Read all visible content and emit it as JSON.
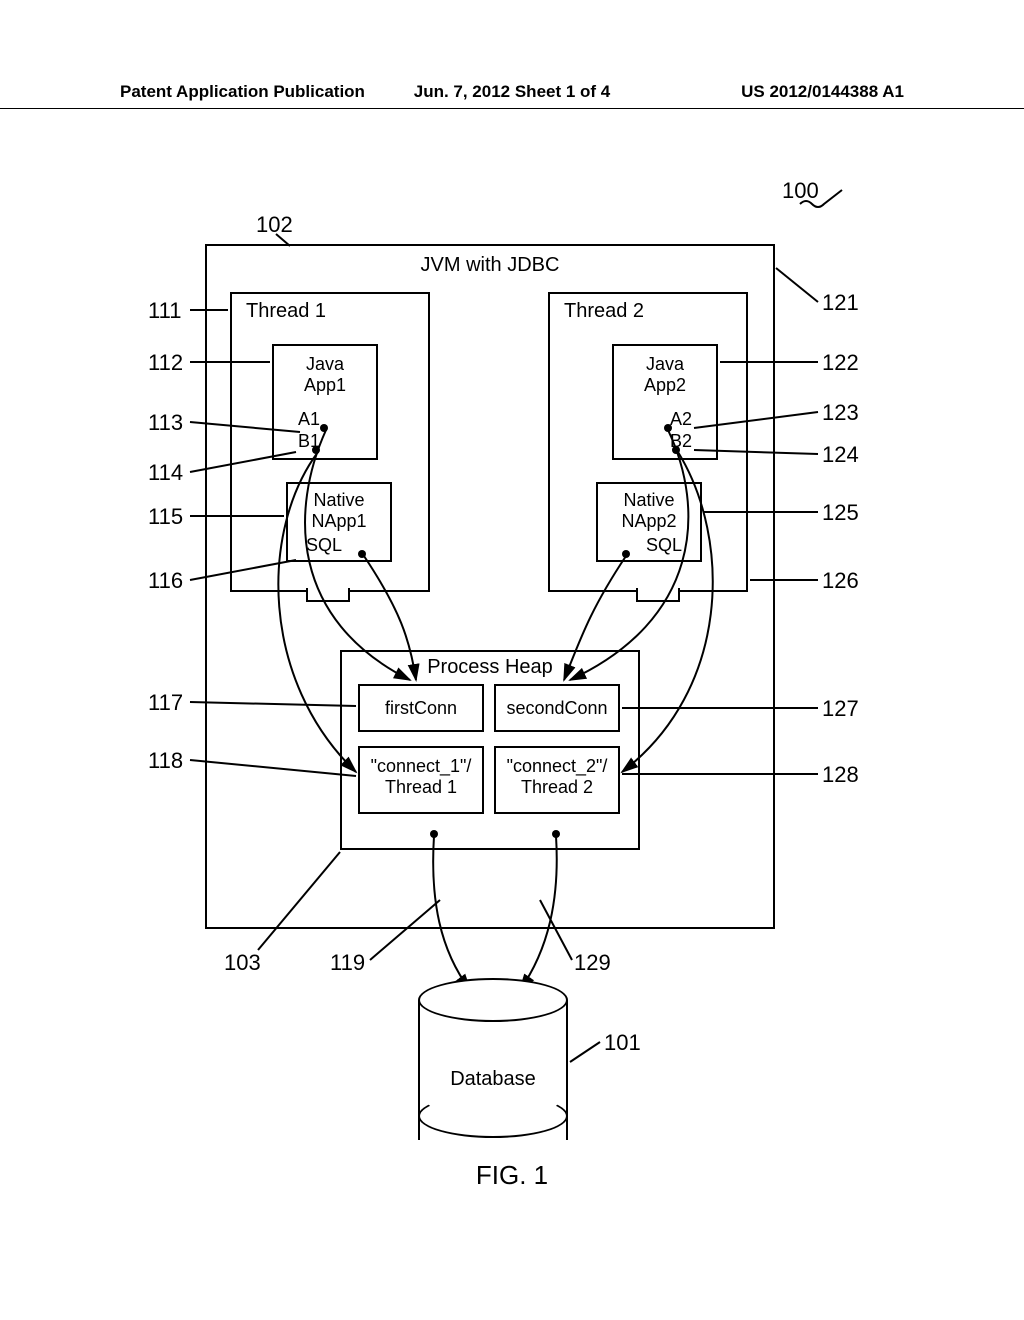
{
  "header": {
    "left": "Patent Application Publication",
    "center": "Jun. 7, 2012  Sheet 1 of 4",
    "right": "US 2012/0144388 A1"
  },
  "refs": {
    "r100": "100",
    "r101": "101",
    "r102": "102",
    "r103": "103",
    "r111": "111",
    "r112": "112",
    "r113": "113",
    "r114": "114",
    "r115": "115",
    "r116": "116",
    "r117": "117",
    "r118": "118",
    "r119": "119",
    "r121": "121",
    "r122": "122",
    "r123": "123",
    "r124": "124",
    "r125": "125",
    "r126": "126",
    "r127": "127",
    "r128": "128",
    "r129": "129"
  },
  "boxes": {
    "jvm": "JVM with JDBC",
    "thread1": "Thread 1",
    "thread2": "Thread 2",
    "javaApp1": "Java\nApp1",
    "javaApp2": "Java\nApp2",
    "a1": "A1",
    "b1": "B1",
    "a2": "A2",
    "b2": "B2",
    "native1": "Native\nNApp1",
    "native2": "Native\nNApp2",
    "sql1": "SQL",
    "sql2": "SQL",
    "processHeap": "Process Heap",
    "firstConn": "firstConn",
    "secondConn": "secondConn",
    "conn1": "\"connect_1\"/\nThread 1",
    "conn2": "\"connect_2\"/\nThread 2",
    "database": "Database"
  },
  "figure": "FIG. 1"
}
